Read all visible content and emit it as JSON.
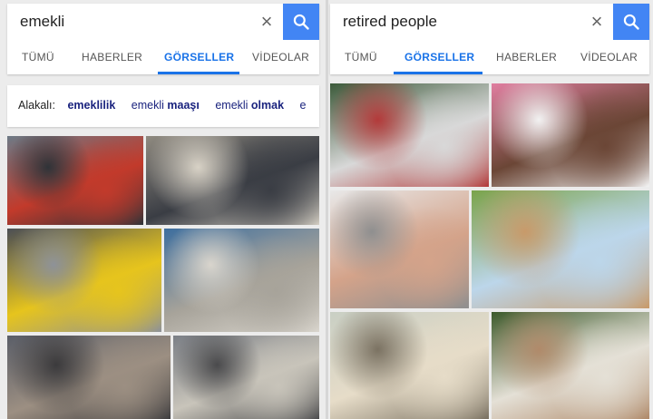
{
  "left": {
    "query": "emekli",
    "tabs": [
      "TÜMÜ",
      "HABERLER",
      "GÖRSELLER",
      "VİDEOLAR"
    ],
    "active_tab": "GÖRSELLER",
    "related_label": "Alakalı:",
    "related": [
      {
        "prefix": "",
        "bold": "emeklilik"
      },
      {
        "prefix": "emekli ",
        "bold": "maaşı"
      },
      {
        "prefix": "emekli ",
        "bold": "olmak"
      },
      {
        "prefix": "e",
        "bold": ""
      }
    ],
    "images": [
      {
        "desc": "queue of elderly people outside a bank building",
        "colors": [
          "#6d7a86",
          "#c23a2b",
          "#2f3338"
        ]
      },
      {
        "desc": "elderly men sitting on chairs, one with white beard",
        "colors": [
          "#8f8a80",
          "#3a3d44",
          "#d8d2c6"
        ]
      },
      {
        "desc": "elderly men using an ATM",
        "colors": [
          "#4b4e55",
          "#e6c41d",
          "#8e9298"
        ]
      },
      {
        "desc": "elderly men sitting in a row, wearing caps",
        "colors": [
          "#3d6e9e",
          "#a7a39a",
          "#d9d5cd"
        ]
      },
      {
        "desc": "crowd of elderly people",
        "colors": [
          "#5a5e68",
          "#9c8f82",
          "#3b3a3c"
        ]
      },
      {
        "desc": "elderly people waiting outside",
        "colors": [
          "#7b7f86",
          "#c8c4ba",
          "#4a4a4c"
        ]
      }
    ]
  },
  "right": {
    "query": "retired people",
    "tabs": [
      "TÜMÜ",
      "GÖRSELLER",
      "HABERLER",
      "VİDEOLAR"
    ],
    "active_tab": "GÖRSELLER",
    "images": [
      {
        "desc": "group of smiling elderly people",
        "colors": [
          "#3c5a3a",
          "#d8d8d8",
          "#b33a3a"
        ]
      },
      {
        "desc": "smiling elderly couple, man in pink shirt",
        "colors": [
          "#e07ea0",
          "#6b4636",
          "#f2f2f2"
        ]
      },
      {
        "desc": "smiling elderly people giving thumbs up",
        "colors": [
          "#e8e8e8",
          "#d4a38a",
          "#8f8f8f"
        ]
      },
      {
        "desc": "elderly couple on a park bench",
        "colors": [
          "#7aa34a",
          "#bcd6ea",
          "#c89a6a"
        ]
      },
      {
        "desc": "elderly couple embracing and smiling",
        "colors": [
          "#c9cfc4",
          "#e6dcc8",
          "#7b7262"
        ]
      },
      {
        "desc": "elderly couple hugging outdoors",
        "colors": [
          "#3c5a2b",
          "#e4e0d6",
          "#b08a6a"
        ]
      }
    ]
  },
  "colors": {
    "accent": "#1a73e8",
    "search_button": "#4285f4",
    "related_link": "#1a237e"
  },
  "icons": {
    "clear": "close-icon",
    "search": "search-icon"
  }
}
